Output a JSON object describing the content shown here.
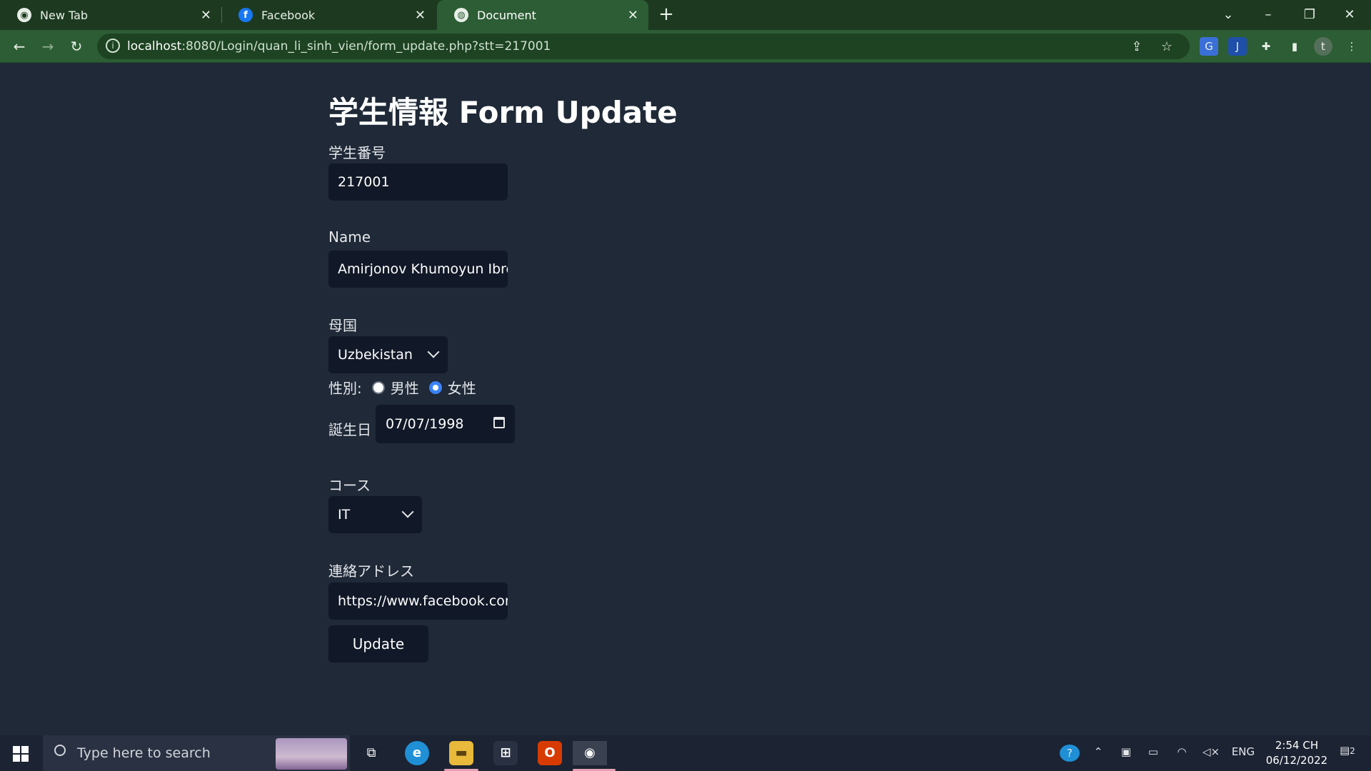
{
  "browser": {
    "tabs": [
      {
        "label": "New Tab",
        "icon": "chrome-icon"
      },
      {
        "label": "Facebook",
        "icon": "facebook-icon"
      },
      {
        "label": "Document",
        "icon": "globe-icon"
      }
    ],
    "address": {
      "host": "localhost",
      "path": ":8080/Login/quan_li_sinh_vien/form_update.php?stt=217001"
    }
  },
  "form": {
    "title": "学生情報 Form Update",
    "student_id_label": "学生番号",
    "student_id_value": "217001",
    "name_label": "Name",
    "name_value": "Amirjonov Khumoyun Ibro",
    "country_label": "母国",
    "country_value": "Uzbekistan",
    "gender_label": "性別:",
    "gender_male": "男性",
    "gender_female": "女性",
    "gender_selected": "女性",
    "birthday_label": "誕生日",
    "birthday_value": "07/07/1998",
    "course_label": "コース",
    "course_value": "IT",
    "contact_label": "連絡アドレス",
    "contact_value": "https://www.facebook.cor",
    "submit_label": "Update"
  },
  "taskbar": {
    "search_placeholder": "Type here to search",
    "language": "ENG",
    "time": "2:54 CH",
    "date": "06/12/2022",
    "notification_count": "2"
  },
  "colors": {
    "page_bg": "#1f2937",
    "field_bg": "#111827",
    "chrome_tabbar": "#1d3a20",
    "chrome_toolbar": "#2c5d34",
    "radio_accent": "#3b82f6"
  }
}
